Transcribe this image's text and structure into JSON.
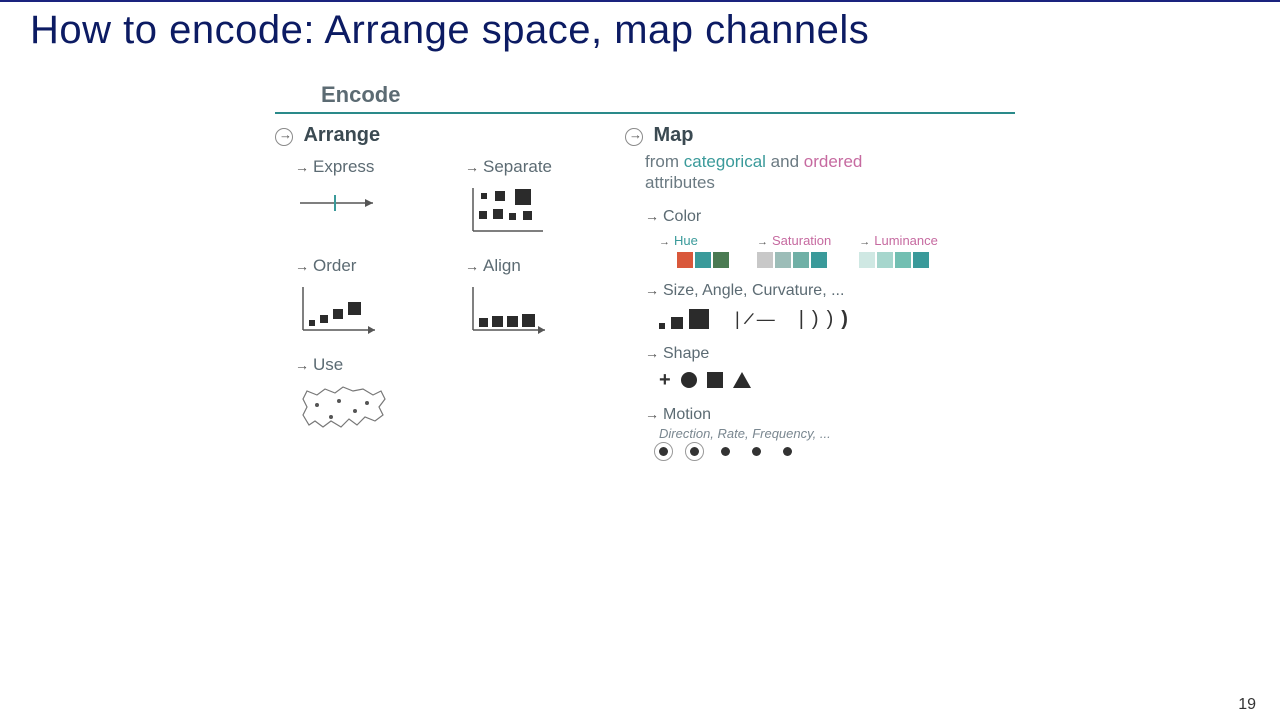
{
  "title": "How to encode:  Arrange space, map channels",
  "page_number": "19",
  "encode": {
    "header": "Encode",
    "arrange": {
      "header": "Arrange",
      "items": {
        "express": "Express",
        "separate": "Separate",
        "order": "Order",
        "align": "Align",
        "use": "Use"
      }
    },
    "map": {
      "header": "Map",
      "desc_prefix": "from ",
      "desc_cat": "categorical",
      "desc_mid": " and ",
      "desc_ord": "ordered",
      "desc_suffix": "attributes",
      "color": {
        "label": "Color",
        "hue": {
          "label": "Hue",
          "swatches": [
            "#f2b233",
            "#d9583b",
            "#3a9a9a",
            "#4a7a52"
          ]
        },
        "saturation": {
          "label": "Saturation",
          "swatches": [
            "#c8c8c8",
            "#9cbdb8",
            "#6fb0a6",
            "#3a9a9a"
          ]
        },
        "luminance": {
          "label": "Luminance",
          "swatches": [
            "#cfe8e3",
            "#a6d6cd",
            "#72bfb2",
            "#3a9a9a"
          ]
        }
      },
      "size": {
        "label": "Size, Angle, Curvature, ..."
      },
      "shape": {
        "label": "Shape"
      },
      "motion": {
        "label": "Motion",
        "sub": "Direction, Rate, Frequency, ..."
      }
    }
  }
}
